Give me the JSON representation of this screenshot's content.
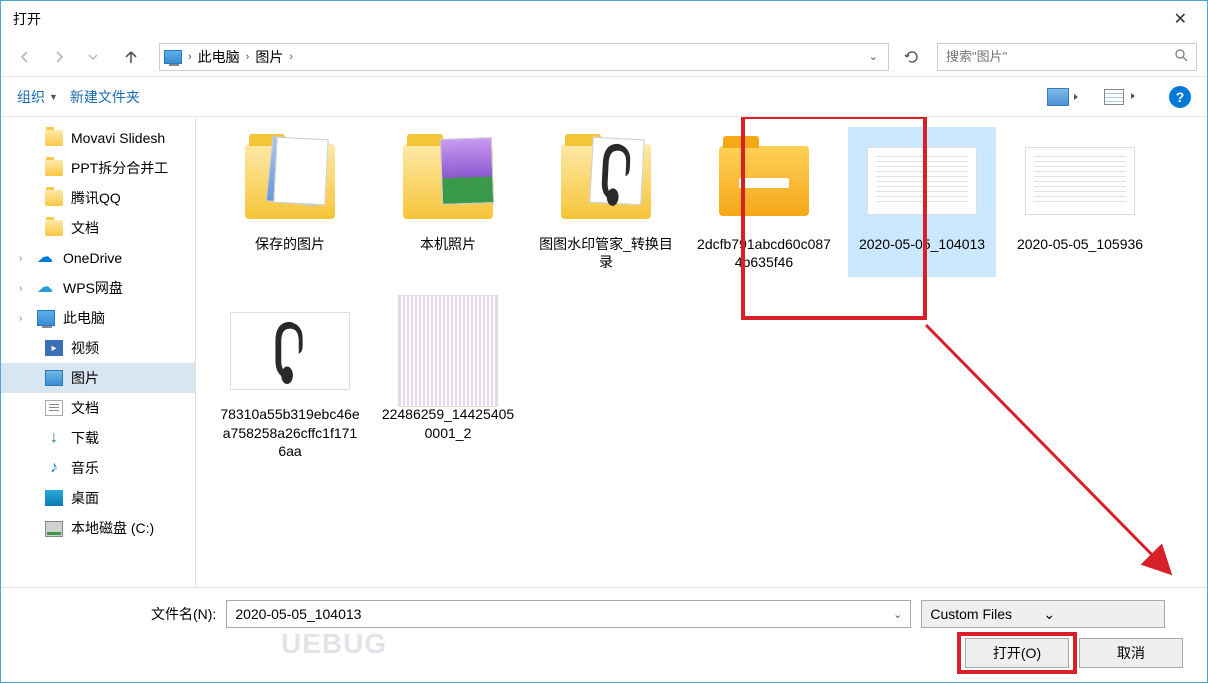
{
  "window": {
    "title": "打开"
  },
  "nav": {
    "crumbs": [
      "此电脑",
      "图片"
    ],
    "search_placeholder": "搜索\"图片\""
  },
  "toolbar": {
    "organize": "组织",
    "newfolder": "新建文件夹",
    "help": "?"
  },
  "sidebar": {
    "items": [
      {
        "id": "movavi",
        "label": "Movavi Slidesh",
        "icon": "folder-icn",
        "lvl": 2
      },
      {
        "id": "ppt",
        "label": "PPT拆分合并工",
        "icon": "folder-icn",
        "lvl": 2
      },
      {
        "id": "qq",
        "label": "腾讯QQ",
        "icon": "folder-icn",
        "lvl": 2
      },
      {
        "id": "wendang1",
        "label": "文档",
        "icon": "folder-icn",
        "lvl": 2
      },
      {
        "id": "onedrive",
        "label": "OneDrive",
        "icon": "onedrive-icn",
        "lvl": 1,
        "expand": true
      },
      {
        "id": "wps",
        "label": "WPS网盘",
        "icon": "wps-icn",
        "lvl": 1,
        "expand": true
      },
      {
        "id": "thispc",
        "label": "此电脑",
        "icon": "thispc-icn",
        "lvl": 1,
        "expand": true
      },
      {
        "id": "video",
        "label": "视频",
        "icon": "video-icn",
        "lvl": 2
      },
      {
        "id": "pictures",
        "label": "图片",
        "icon": "pic-icn",
        "lvl": 2,
        "active": true
      },
      {
        "id": "docs",
        "label": "文档",
        "icon": "doc-icn",
        "lvl": 2
      },
      {
        "id": "downloads",
        "label": "下载",
        "icon": "dl-icn",
        "lvl": 2
      },
      {
        "id": "music",
        "label": "音乐",
        "icon": "music-icn",
        "lvl": 2
      },
      {
        "id": "desktop",
        "label": "桌面",
        "icon": "desktop-icn",
        "lvl": 2
      },
      {
        "id": "cdrive",
        "label": "本地磁盘 (C:)",
        "icon": "disk-icn",
        "lvl": 2
      }
    ]
  },
  "files": [
    {
      "id": "saved",
      "label": "保存的图片",
      "type": "folder-pics"
    },
    {
      "id": "camera",
      "label": "本机照片",
      "type": "folder-photo"
    },
    {
      "id": "watermark",
      "label": "图图水印管家_转换目录",
      "type": "folder-headset"
    },
    {
      "id": "hex1",
      "label": "2dcfb791abcd60c0874b635f46",
      "type": "folder-orange"
    },
    {
      "id": "ss1",
      "label": "2020-05-05_104013",
      "type": "doc-thumb",
      "selected": true
    },
    {
      "id": "ss2",
      "label": "2020-05-05_105936",
      "type": "doc-thumb2"
    },
    {
      "id": "hex2",
      "label": "78310a55b319ebc46ea758258a26cffc1f1716aa",
      "type": "headset-img"
    },
    {
      "id": "num",
      "label": "22486259_144254050001_2",
      "type": "striped"
    }
  ],
  "footer": {
    "filename_label": "文件名(N):",
    "filename_value": "2020-05-05_104013",
    "filter": "Custom Files",
    "open": "打开(O)",
    "cancel": "取消"
  },
  "watermark": "UEBUG"
}
